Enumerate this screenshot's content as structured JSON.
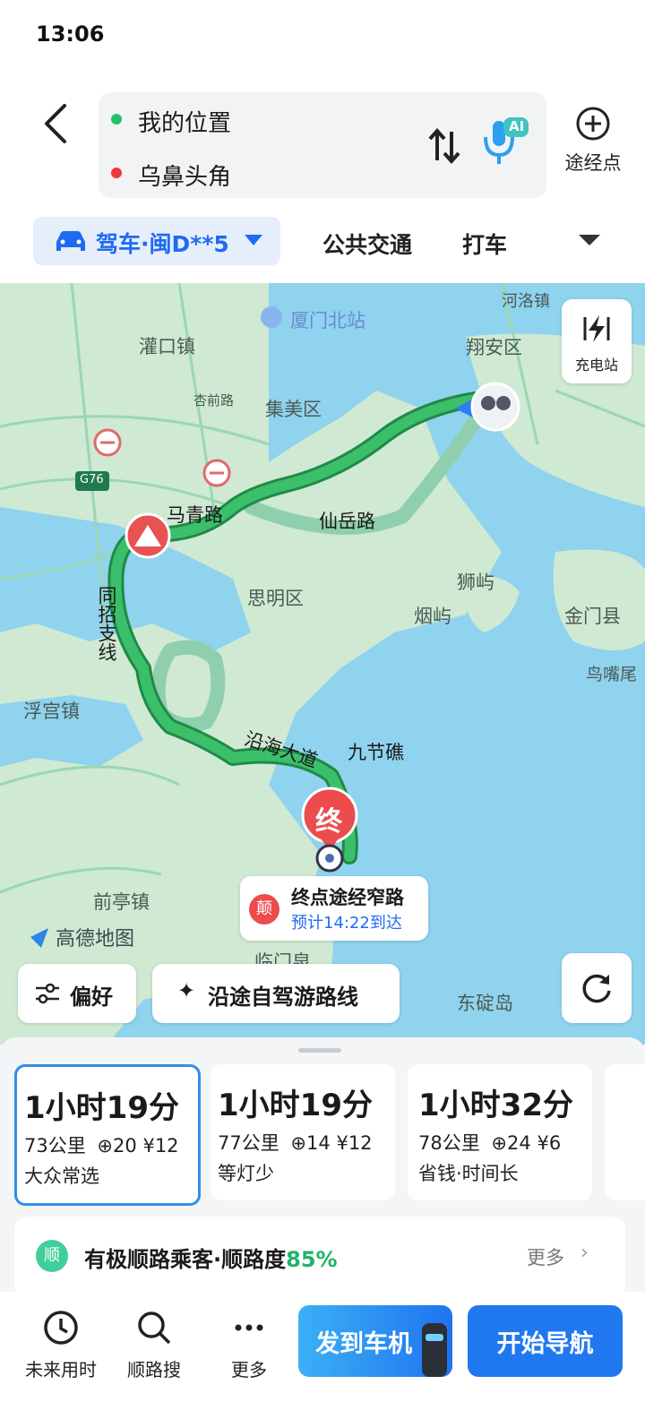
{
  "status_bar": {
    "time": "13:06"
  },
  "search": {
    "origin": "我的位置",
    "destination": "乌鼻头角",
    "via_label": "途经点",
    "ai_badge": "AI"
  },
  "modes": {
    "selected": "驾车·闽D**5",
    "transit": "公共交通",
    "taxi": "打车"
  },
  "map": {
    "labels": [
      "厦门北站",
      "灌口镇",
      "翔安区",
      "杏前路",
      "集美区",
      "G76",
      "马青路",
      "仙岳路",
      "思明区",
      "狮屿",
      "烟屿",
      "金门县",
      "同招支线",
      "浮宫镇",
      "鸟嘴尾",
      "九节礁",
      "沿海大道",
      "前亭镇",
      "临门泉",
      "东碇岛",
      "河洛镇"
    ],
    "charge_label": "充电站",
    "end_marker": "终",
    "bubble": {
      "badge": "颠",
      "title": "终点途经窄路",
      "eta": "预计14:22到达"
    },
    "brand": "高德地图",
    "prefs_label": "偏好",
    "selfdrive_label": "沿途自驾游路线"
  },
  "routes": [
    {
      "duration": "1小时19分",
      "distance": "73公里",
      "lights": "20",
      "toll": "¥12",
      "tag": "大众常选",
      "selected": true
    },
    {
      "duration": "1小时19分",
      "distance": "77公里",
      "lights": "14",
      "toll": "¥12",
      "tag": "等灯少",
      "selected": false
    },
    {
      "duration": "1小时32分",
      "distance": "78公里",
      "lights": "24",
      "toll": "¥6",
      "tag": "省钱·时间长",
      "selected": false
    }
  ],
  "carpool": {
    "badge": "顺",
    "text": "有极顺路乘客·顺路度",
    "percent": "85%",
    "more": "更多"
  },
  "bottom": {
    "future": "未来用时",
    "search_along": "顺路搜",
    "more": "更多",
    "send_car": "发到车机",
    "start_nav": "开始导航"
  },
  "colors": {
    "accent": "#1f6bf0",
    "route_main": "#22a55a",
    "route_alt": "#8fcfae",
    "sea": "#8fd3ee",
    "land": "#cfe9d2",
    "end_red": "#ec4c4c"
  }
}
